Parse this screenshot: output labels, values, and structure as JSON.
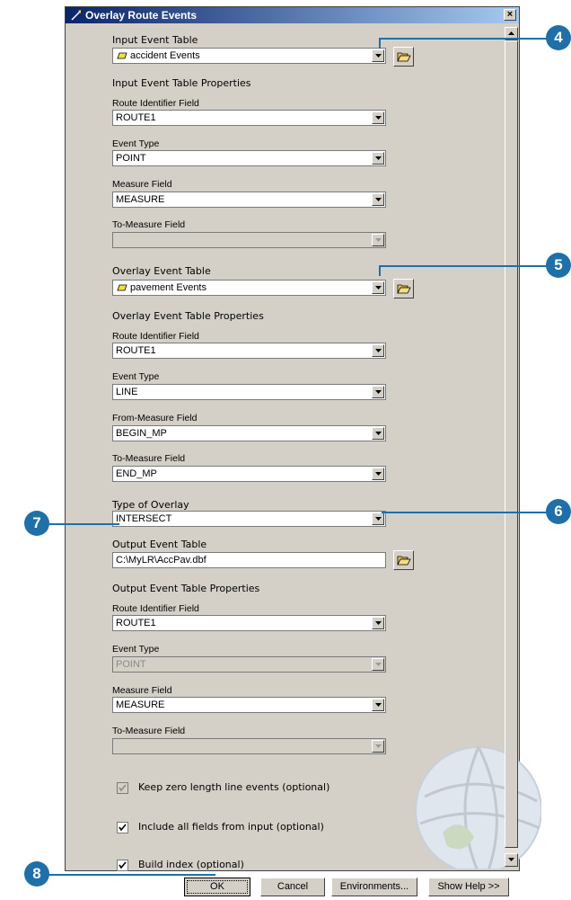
{
  "window": {
    "title": "Overlay Route Events"
  },
  "input": {
    "section_label": "Input Event Table",
    "table_value": "accident Events",
    "properties_label": "Input Event Table Properties",
    "route_id_label": "Route Identifier Field",
    "route_id_value": "ROUTE1",
    "event_type_label": "Event Type",
    "event_type_value": "POINT",
    "measure_label": "Measure Field",
    "measure_value": "MEASURE",
    "to_measure_label": "To-Measure Field",
    "to_measure_value": ""
  },
  "overlay": {
    "section_label": "Overlay Event Table",
    "table_value": "pavement Events",
    "properties_label": "Overlay Event Table Properties",
    "route_id_label": "Route Identifier Field",
    "route_id_value": "ROUTE1",
    "event_type_label": "Event Type",
    "event_type_value": "LINE",
    "from_measure_label": "From-Measure Field",
    "from_measure_value": "BEGIN_MP",
    "to_measure_label": "To-Measure Field",
    "to_measure_value": "END_MP"
  },
  "overlay_type": {
    "label": "Type of Overlay",
    "value": "INTERSECT"
  },
  "output": {
    "section_label": "Output Event Table",
    "table_value": "C:\\MyLR\\AccPav.dbf",
    "properties_label": "Output Event Table Properties",
    "route_id_label": "Route Identifier Field",
    "route_id_value": "ROUTE1",
    "event_type_label": "Event Type",
    "event_type_value": "POINT",
    "measure_label": "Measure Field",
    "measure_value": "MEASURE",
    "to_measure_label": "To-Measure Field",
    "to_measure_value": ""
  },
  "options": {
    "keep_zero_label": "Keep zero length line events (optional)",
    "keep_zero_checked": true,
    "keep_zero_enabled": false,
    "include_all_label": "Include all fields from input (optional)",
    "include_all_checked": true,
    "build_index_label": "Build index (optional)",
    "build_index_checked": true
  },
  "buttons": {
    "ok": "OK",
    "cancel": "Cancel",
    "environments": "Environments...",
    "show_help": "Show Help >>"
  },
  "callouts": {
    "c4": "4",
    "c5": "5",
    "c6": "6",
    "c7": "7",
    "c8": "8"
  },
  "colors": {
    "callout": "#1f6fa8",
    "title_bar": "#0a246a"
  }
}
